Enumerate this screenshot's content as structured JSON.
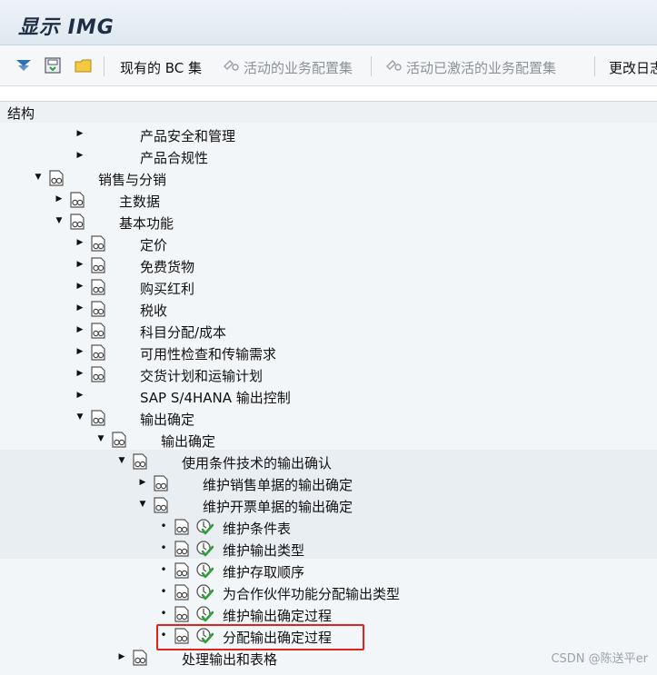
{
  "window": {
    "title": "显示 IMG"
  },
  "toolbar": {
    "existing_bc_sets": "现有的 BC 集",
    "active_bc_sets": "活动的业务配置集",
    "activated_bc_sets": "活动已激活的业务配置集",
    "change_log": "更改日志"
  },
  "header": {
    "structure": "结构"
  },
  "tree": [
    {
      "id": "n1",
      "label": "产品安全和管理",
      "level": 3,
      "expander": "collapsed",
      "icon": false,
      "exec": false
    },
    {
      "id": "n2",
      "label": "产品合规性",
      "level": 3,
      "expander": "collapsed",
      "icon": false,
      "exec": false
    },
    {
      "id": "n3",
      "label": "销售与分销",
      "level": 1,
      "expander": "expanded",
      "icon": true,
      "exec": false
    },
    {
      "id": "n4",
      "label": "主数据",
      "level": 2,
      "expander": "collapsed",
      "icon": true,
      "exec": false
    },
    {
      "id": "n5",
      "label": "基本功能",
      "level": 2,
      "expander": "expanded",
      "icon": true,
      "exec": false
    },
    {
      "id": "n6",
      "label": "定价",
      "level": 3,
      "expander": "collapsed",
      "icon": true,
      "exec": false
    },
    {
      "id": "n7",
      "label": "免费货物",
      "level": 3,
      "expander": "collapsed",
      "icon": true,
      "exec": false
    },
    {
      "id": "n8",
      "label": "购买红利",
      "level": 3,
      "expander": "collapsed",
      "icon": true,
      "exec": false
    },
    {
      "id": "n9",
      "label": "税收",
      "level": 3,
      "expander": "collapsed",
      "icon": true,
      "exec": false
    },
    {
      "id": "n10",
      "label": "科目分配/成本",
      "level": 3,
      "expander": "collapsed",
      "icon": true,
      "exec": false
    },
    {
      "id": "n11",
      "label": "可用性检查和传输需求",
      "level": 3,
      "expander": "collapsed",
      "icon": true,
      "exec": false
    },
    {
      "id": "n12",
      "label": "交货计划和运输计划",
      "level": 3,
      "expander": "collapsed",
      "icon": true,
      "exec": false
    },
    {
      "id": "n13",
      "label": "SAP S/4HANA 输出控制",
      "level": 3,
      "expander": "collapsed",
      "icon": false,
      "exec": false
    },
    {
      "id": "n14",
      "label": "输出确定",
      "level": 3,
      "expander": "expanded",
      "icon": true,
      "exec": false
    },
    {
      "id": "n15",
      "label": "输出确定",
      "level": 4,
      "expander": "expanded",
      "icon": true,
      "exec": false
    },
    {
      "id": "n16",
      "label": "使用条件技术的输出确认",
      "level": 5,
      "expander": "expanded",
      "icon": true,
      "exec": false
    },
    {
      "id": "n17",
      "label": "维护销售单据的输出确定",
      "level": 6,
      "expander": "collapsed",
      "icon": true,
      "exec": false
    },
    {
      "id": "n18",
      "label": "维护开票单据的输出确定",
      "level": 6,
      "expander": "expanded",
      "icon": true,
      "exec": false
    },
    {
      "id": "n19",
      "label": "维护条件表",
      "level": 7,
      "expander": "leaf",
      "icon": true,
      "exec": true
    },
    {
      "id": "n20",
      "label": "维护输出类型",
      "level": 7,
      "expander": "leaf",
      "icon": true,
      "exec": true
    },
    {
      "id": "n21",
      "label": "维护存取顺序",
      "level": 7,
      "expander": "leaf",
      "icon": true,
      "exec": true
    },
    {
      "id": "n22",
      "label": "为合作伙伴功能分配输出类型",
      "level": 7,
      "expander": "leaf",
      "icon": true,
      "exec": true
    },
    {
      "id": "n23",
      "label": "维护输出确定过程",
      "level": 7,
      "expander": "leaf",
      "icon": true,
      "exec": true
    },
    {
      "id": "n24",
      "label": "分配输出确定过程",
      "level": 7,
      "expander": "leaf",
      "icon": true,
      "exec": true
    },
    {
      "id": "n25",
      "label": "处理输出和表格",
      "level": 5,
      "expander": "collapsed",
      "icon": true,
      "exec": false
    }
  ],
  "watermark": "CSDN @陈送平er",
  "colors": {
    "highlight": "#e2231a",
    "exec_check": "#2e9d3a"
  }
}
